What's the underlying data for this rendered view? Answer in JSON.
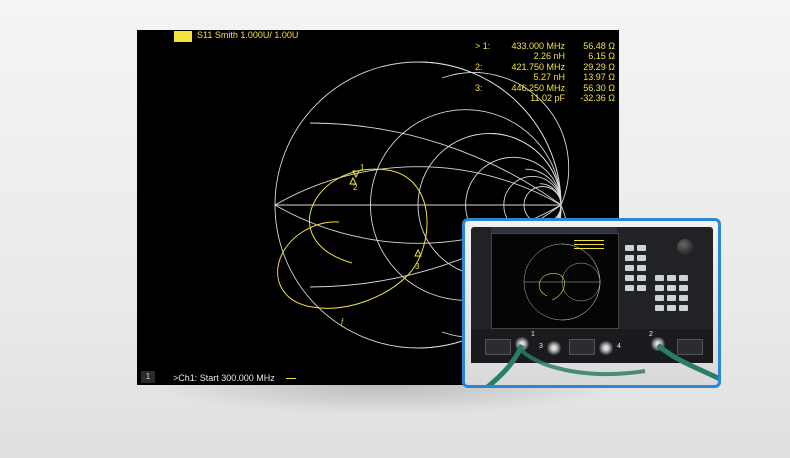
{
  "trace_title": "S11 Smith 1.000U/  1.00U",
  "markers": [
    {
      "num": "> 1:",
      "v1": "433.000 MHz",
      "v2": "56.48 Ω"
    },
    {
      "num": "",
      "v1": "2.26 nH",
      "v2": "6.15 Ω"
    },
    {
      "num": "2:",
      "v1": "421.750 MHz",
      "v2": "29.29 Ω"
    },
    {
      "num": "",
      "v1": "5.27 nH",
      "v2": "13.97 Ω"
    },
    {
      "num": "3:",
      "v1": "446.250 MHz",
      "v2": "56.30 Ω"
    },
    {
      "num": "",
      "v1": "11.02 pF",
      "v2": "-32.36 Ω"
    }
  ],
  "chart_markers": {
    "m1": "1",
    "m2": "2",
    "m3": "3",
    "trace_label": "f"
  },
  "footer": {
    "index": "1",
    "text": ">Ch1: Start  300.000 MHz"
  },
  "photo": {
    "port_labels": [
      "1",
      "2",
      "3",
      "4"
    ]
  },
  "colors": {
    "trace": "#f2e23c",
    "grid": "#d9d9d9",
    "frame": "#2b86d6"
  }
}
